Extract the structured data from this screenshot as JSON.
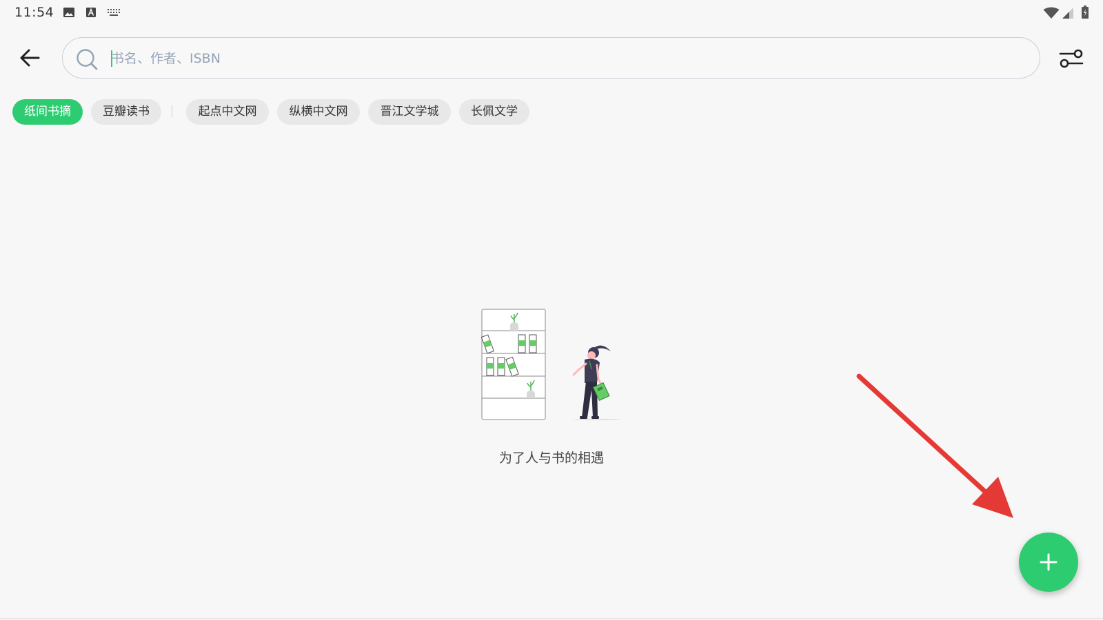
{
  "status_bar": {
    "time": "11:54",
    "left_icons": [
      "image-icon",
      "text-a-icon",
      "keyboard-icon"
    ],
    "right_icons": [
      "wifi-icon",
      "cell-signal-icon",
      "battery-icon"
    ]
  },
  "toolbar": {
    "back_icon": "arrow-left-icon",
    "search_placeholder": "书名、作者、ISBN",
    "search_value": "",
    "search_icon": "search-icon",
    "filter_icon": "filter-sliders-icon"
  },
  "sources": {
    "items": [
      {
        "label": "纸间书摘",
        "active": true
      },
      {
        "label": "豆瓣读书",
        "active": false
      },
      {
        "label": "起点中文网",
        "active": false
      },
      {
        "label": "纵横中文网",
        "active": false
      },
      {
        "label": "晋江文学城",
        "active": false
      },
      {
        "label": "长佩文学",
        "active": false
      }
    ]
  },
  "empty_state": {
    "illustration": "bookshelf-reader-illustration",
    "message": "为了人与书的相遇"
  },
  "fab": {
    "icon": "plus-icon"
  },
  "annotation": {
    "icon": "red-arrow-icon"
  },
  "colors": {
    "accent": "#2ecc71",
    "chip_bg": "#e8e8e8",
    "background": "#f7f7f7",
    "annotation_red": "#e53935"
  }
}
